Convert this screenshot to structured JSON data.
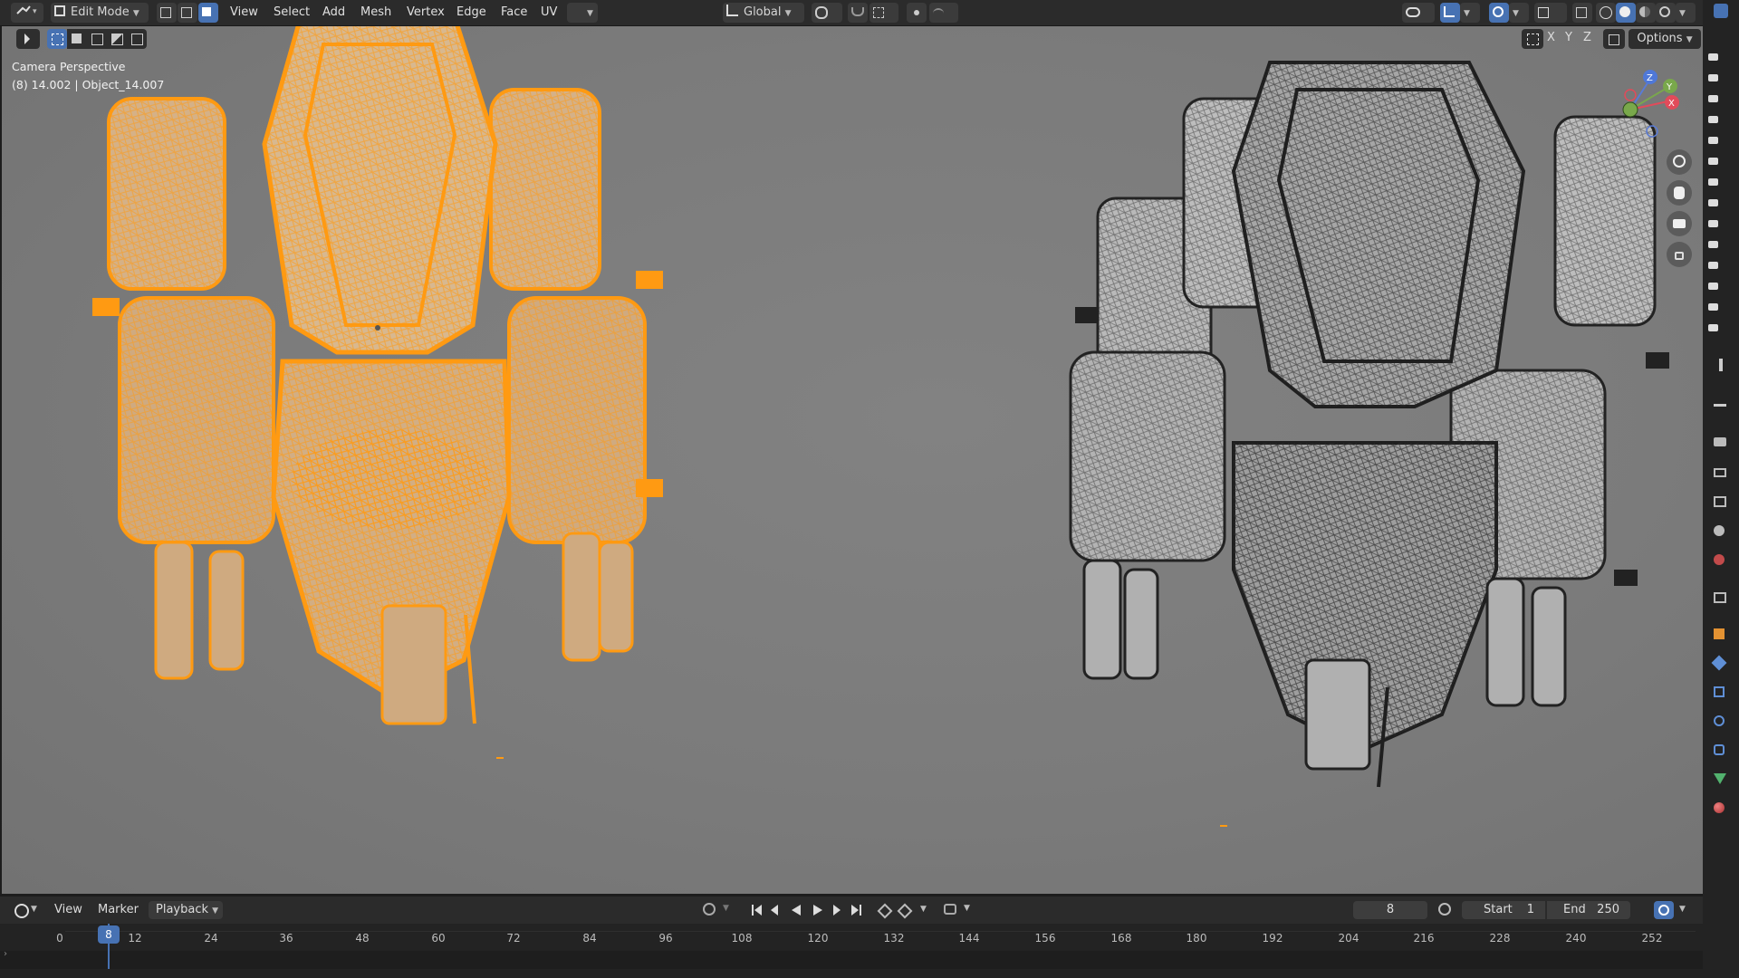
{
  "header": {
    "mode_label": "Edit Mode",
    "menus": [
      "View",
      "Select",
      "Add",
      "Mesh",
      "Vertex",
      "Edge",
      "Face",
      "UV"
    ],
    "orientation_label": "Global",
    "options_label": "Options",
    "axis_labels": [
      "X",
      "Y",
      "Z"
    ]
  },
  "viewport": {
    "camera_label": "Camera Perspective",
    "object_label": "(8) 14.002 | Object_14.007",
    "selected_color": "#ff9f1c",
    "wire_color": "#2a2a2a"
  },
  "gizmo": {
    "x_label": "X",
    "y_label": "Y",
    "z_label": "Z"
  },
  "timeline": {
    "menus": [
      "View",
      "Marker",
      "Playback"
    ],
    "current_frame": "8",
    "start_label": "Start",
    "start_value": "1",
    "end_label": "End",
    "end_value": "250",
    "frame_ticks": [
      "0",
      "12",
      "24",
      "36",
      "48",
      "60",
      "72",
      "84",
      "96",
      "108",
      "120",
      "132",
      "144",
      "156",
      "168",
      "180",
      "192",
      "204",
      "216",
      "228",
      "240",
      "252"
    ],
    "playhead_label": "8"
  },
  "colors": {
    "accent_blue": "#4772b3",
    "viewport_bg": "#7a7a7a",
    "header_bg": "#2b2b2b"
  }
}
